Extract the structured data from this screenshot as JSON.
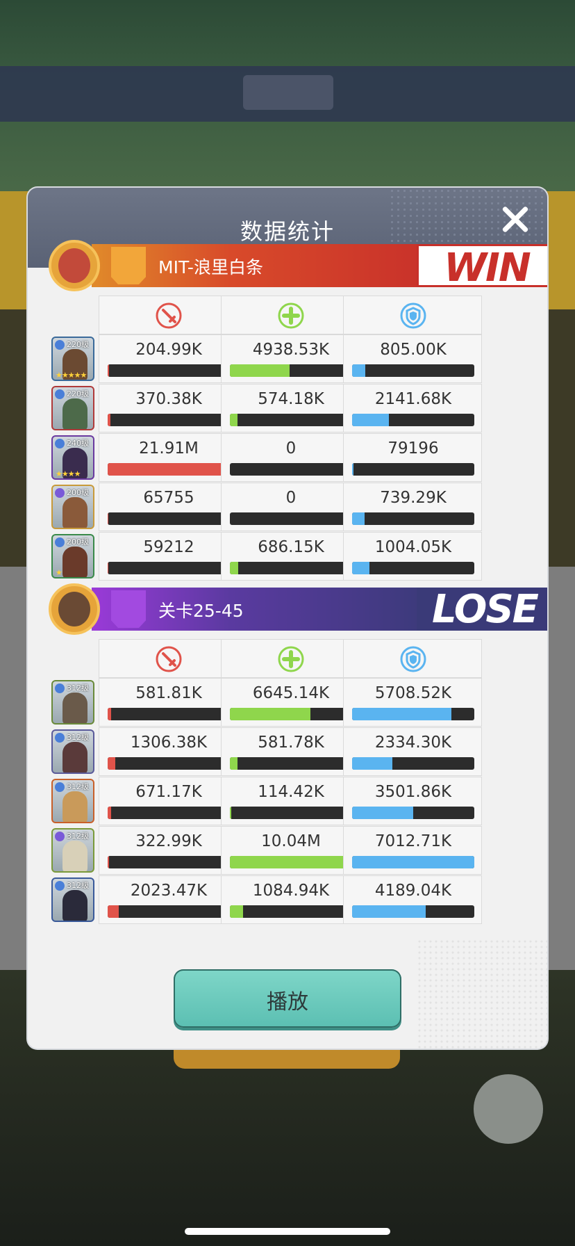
{
  "dialog": {
    "title": "数据统计",
    "play_label": "播放"
  },
  "colors": {
    "damage": "#e0534a",
    "heal": "#8fd64c",
    "tank": "#5ab4f0",
    "win": "#c8302a",
    "lose": "#3a3a78"
  },
  "stat_icons": [
    "damage-sword-icon",
    "heal-plus-icon",
    "shield-icon"
  ],
  "teams": [
    {
      "name": "MIT-浪里白条",
      "result": "WIN",
      "heroes": [
        {
          "level": "220级",
          "stars": "★★★★★",
          "damage": {
            "text": "204.99K",
            "pct": 1
          },
          "heal": {
            "text": "4938.53K",
            "pct": 49
          },
          "tank": {
            "text": "805.00K",
            "pct": 11
          }
        },
        {
          "level": "220级",
          "stars": "",
          "damage": {
            "text": "370.38K",
            "pct": 2
          },
          "heal": {
            "text": "574.18K",
            "pct": 6
          },
          "tank": {
            "text": "2141.68K",
            "pct": 30
          }
        },
        {
          "level": "240级",
          "stars": "★★★★",
          "damage": {
            "text": "21.91M",
            "pct": 100
          },
          "heal": {
            "text": "0",
            "pct": 0
          },
          "tank": {
            "text": "79196",
            "pct": 1
          }
        },
        {
          "level": "200级",
          "stars": "",
          "damage": {
            "text": "65755",
            "pct": 0.5
          },
          "heal": {
            "text": "0",
            "pct": 0
          },
          "tank": {
            "text": "739.29K",
            "pct": 10
          }
        },
        {
          "level": "200级",
          "stars": "★",
          "damage": {
            "text": "59212",
            "pct": 0.5
          },
          "heal": {
            "text": "686.15K",
            "pct": 7
          },
          "tank": {
            "text": "1004.05K",
            "pct": 14
          }
        }
      ]
    },
    {
      "name": "关卡25-45",
      "result": "LOSE",
      "heroes": [
        {
          "level": "312级",
          "stars": "",
          "damage": {
            "text": "581.81K",
            "pct": 3
          },
          "heal": {
            "text": "6645.14K",
            "pct": 66
          },
          "tank": {
            "text": "5708.52K",
            "pct": 81
          }
        },
        {
          "level": "312级",
          "stars": "",
          "damage": {
            "text": "1306.38K",
            "pct": 6
          },
          "heal": {
            "text": "581.78K",
            "pct": 6
          },
          "tank": {
            "text": "2334.30K",
            "pct": 33
          }
        },
        {
          "level": "312级",
          "stars": "",
          "damage": {
            "text": "671.17K",
            "pct": 3
          },
          "heal": {
            "text": "114.42K",
            "pct": 1
          },
          "tank": {
            "text": "3501.86K",
            "pct": 50
          }
        },
        {
          "level": "312级",
          "stars": "",
          "damage": {
            "text": "322.99K",
            "pct": 1
          },
          "heal": {
            "text": "10.04M",
            "pct": 100
          },
          "tank": {
            "text": "7012.71K",
            "pct": 100
          }
        },
        {
          "level": "312级",
          "stars": "",
          "damage": {
            "text": "2023.47K",
            "pct": 9
          },
          "heal": {
            "text": "1084.94K",
            "pct": 11
          },
          "tank": {
            "text": "4189.04K",
            "pct": 60
          }
        }
      ]
    }
  ]
}
